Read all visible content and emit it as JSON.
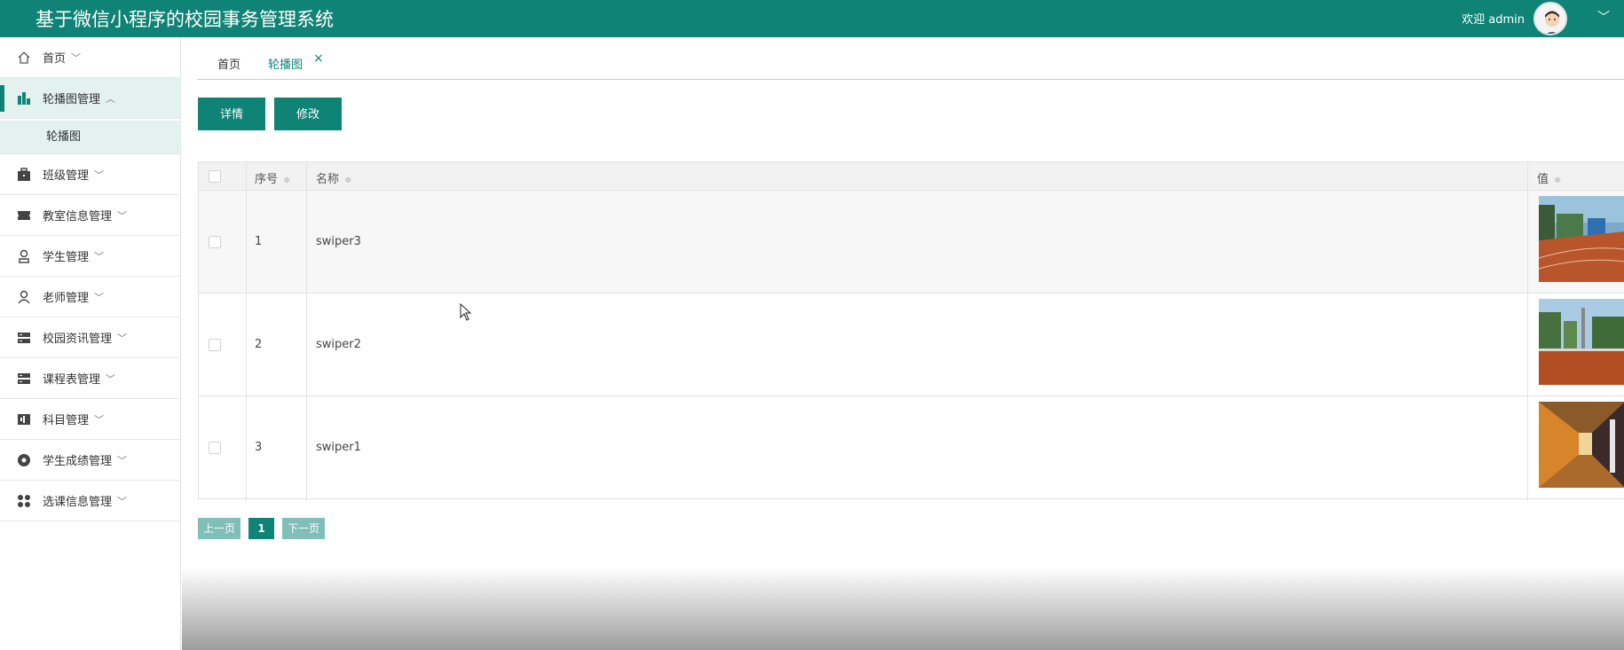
{
  "header": {
    "title": "基于微信小程序的校园事务管理系统",
    "welcome": "欢迎 admin",
    "avatar_icon": "user-avatar",
    "chevron_icon": "chevron-down-icon"
  },
  "sidebar": {
    "items": [
      {
        "label": "首页",
        "icon": "home-icon",
        "expanded": false
      },
      {
        "label": "轮播图管理",
        "icon": "chart-icon",
        "expanded": true
      },
      {
        "label": "班级管理",
        "icon": "briefcase-icon",
        "expanded": false
      },
      {
        "label": "教室信息管理",
        "icon": "ticket-icon",
        "expanded": false
      },
      {
        "label": "学生管理",
        "icon": "student-icon",
        "expanded": false
      },
      {
        "label": "老师管理",
        "icon": "person-icon",
        "expanded": false
      },
      {
        "label": "校园资讯管理",
        "icon": "server-icon",
        "expanded": false
      },
      {
        "label": "课程表管理",
        "icon": "server-icon",
        "expanded": false
      },
      {
        "label": "科目管理",
        "icon": "book-icon",
        "expanded": false
      },
      {
        "label": "学生成绩管理",
        "icon": "disc-icon",
        "expanded": false
      },
      {
        "label": "选课信息管理",
        "icon": "grid-icon",
        "expanded": false
      }
    ],
    "subitem": "轮播图"
  },
  "tabs": {
    "home": "首页",
    "current": "轮播图",
    "close": "×"
  },
  "toolbar": {
    "detail": "详情",
    "edit": "修改"
  },
  "table": {
    "headers": {
      "index": "序号",
      "name": "名称",
      "value": "值"
    },
    "sort_icon": "≑",
    "rows": [
      {
        "index": "1",
        "name": "swiper3",
        "image": "track-field-photo"
      },
      {
        "index": "2",
        "name": "swiper2",
        "image": "playground-photo"
      },
      {
        "index": "3",
        "name": "swiper1",
        "image": "corridor-photo"
      }
    ]
  },
  "pagination": {
    "prev": "上一页",
    "current": "1",
    "next": "下一页"
  },
  "colors": {
    "primary": "#0f8375",
    "active_bg": "#e3f1ef",
    "disabled": "#7fbfb8"
  }
}
